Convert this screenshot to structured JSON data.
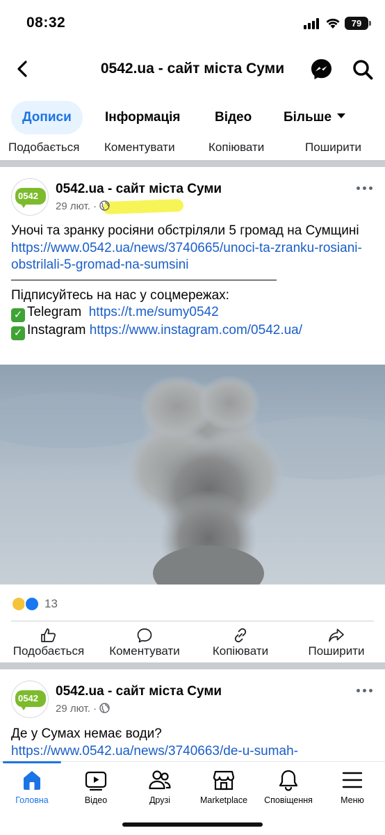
{
  "status_bar": {
    "time": "08:32",
    "battery": "79"
  },
  "header": {
    "title": "0542.ua - сайт міста Суми"
  },
  "tabs": [
    {
      "label": "Дописи"
    },
    {
      "label": "Інформація"
    },
    {
      "label": "Відео"
    },
    {
      "label": "Більше"
    }
  ],
  "actions": {
    "like": "Подобається",
    "comment": "Коментувати",
    "copy": "Копіювати",
    "share": "Поширити"
  },
  "post1": {
    "author": "0542.ua - сайт міста Суми",
    "avatar_text": "0542",
    "date": "29 лют.",
    "text_line1": "Уночі та зранку росіяни обстріляли 5 громад на Сумщині",
    "link": "https://www.0542.ua/news/3740665/unoci-ta-zranku-rosiani-obstrilali-5-gromad-na-sumsini",
    "subscribe": "Підписуйтесь на нас у соцмережах:",
    "telegram_label": "Telegram",
    "telegram_link": "https://t.me/sumy0542",
    "instagram_label": "Instagram",
    "instagram_link": "https://www.instagram.com/0542.ua/",
    "reaction_count": "13"
  },
  "post2": {
    "author": "0542.ua - сайт міста Суми",
    "avatar_text": "0542",
    "date": "29 лют.",
    "text_line1": "Де у Сумах немає води?",
    "link": "https://www.0542.ua/news/3740663/de-u-sumah-"
  },
  "bottom_nav": [
    {
      "label": "Головна"
    },
    {
      "label": "Відео"
    },
    {
      "label": "Друзі"
    },
    {
      "label": "Marketplace"
    },
    {
      "label": "Сповіщення"
    },
    {
      "label": "Меню"
    }
  ],
  "colors": {
    "accent": "#1b74e4",
    "link": "#1a5ec9",
    "brand_green": "#7dbb2d",
    "highlight": "#f6f23a"
  }
}
